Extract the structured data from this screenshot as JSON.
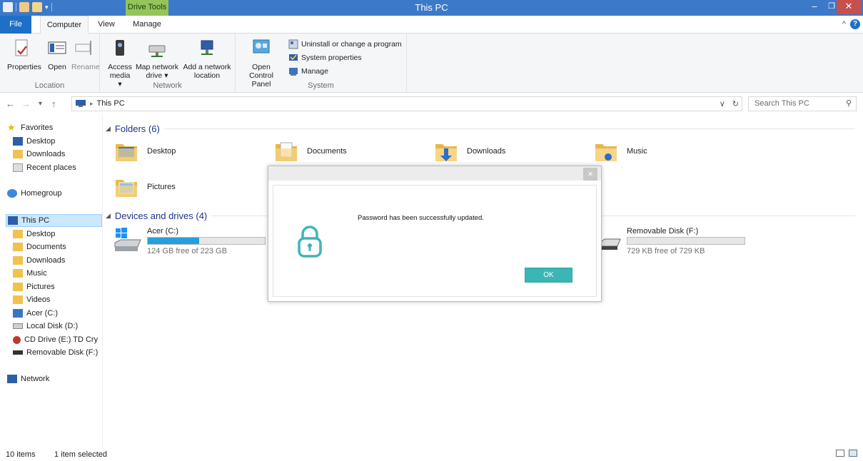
{
  "window": {
    "title": "This PC",
    "context_tab": "Drive Tools",
    "controls": {
      "minimize": "–",
      "maximize": "❐",
      "close": "✕"
    }
  },
  "tabs": {
    "file": "File",
    "computer": "Computer",
    "view": "View",
    "manage": "Manage"
  },
  "ribbon": {
    "location": {
      "label": "Location",
      "properties": "Properties",
      "open": "Open",
      "rename": "Rename"
    },
    "network": {
      "label": "Network",
      "access_media_1": "Access",
      "access_media_2": "media ▾",
      "map_drive_1": "Map network",
      "map_drive_2": "drive ▾",
      "add_location_1": "Add a network",
      "add_location_2": "location"
    },
    "system": {
      "label": "System",
      "control_panel_1": "Open Control",
      "control_panel_2": "Panel",
      "uninstall": "Uninstall or change a program",
      "system_properties": "System properties",
      "manage": "Manage"
    }
  },
  "address": {
    "back": "←",
    "forward": "→",
    "recent": "▾",
    "up": "↑",
    "crumb_sep": "▸",
    "crumb": "This PC",
    "dropdown": "∨",
    "refresh": "↻",
    "search_placeholder": "Search This PC",
    "search_icon": "⚲"
  },
  "navpane": {
    "favorites": "Favorites",
    "desktop": "Desktop",
    "downloads": "Downloads",
    "recent_places": "Recent places",
    "homegroup": "Homegroup",
    "this_pc": "This PC",
    "pc_desktop": "Desktop",
    "pc_documents": "Documents",
    "pc_downloads": "Downloads",
    "pc_music": "Music",
    "pc_pictures": "Pictures",
    "pc_videos": "Videos",
    "acer": "Acer (C:)",
    "local_disk": "Local Disk (D:)",
    "cd_drive": "CD Drive (E:) TD Cry",
    "removable": "Removable Disk (F:)",
    "network": "Network"
  },
  "content": {
    "folders_header": "Folders (6)",
    "devices_header": "Devices and drives (4)",
    "folders": {
      "desktop": "Desktop",
      "documents": "Documents",
      "downloads": "Downloads",
      "music": "Music",
      "pictures": "Pictures"
    },
    "drives": {
      "c_name": "Acer (C:)",
      "c_free": "124 GB free of 223 GB",
      "c_used_fraction": 0.44,
      "f_name": "Removable Disk (F:)",
      "f_free": "729 KB free of 729 KB",
      "f_used_fraction": 0.0
    }
  },
  "statusbar": {
    "items": "10 items",
    "selected": "1 item selected"
  },
  "dialog": {
    "close": "×",
    "message": "Password has been successfully updated.",
    "ok": "OK"
  },
  "colors": {
    "titlebar": "#3c79c8",
    "drive_tools": "#94c45a",
    "file_tab": "#1e6fc8",
    "accent_teal": "#3cb6b5",
    "drive_fill": "#26a0da"
  }
}
